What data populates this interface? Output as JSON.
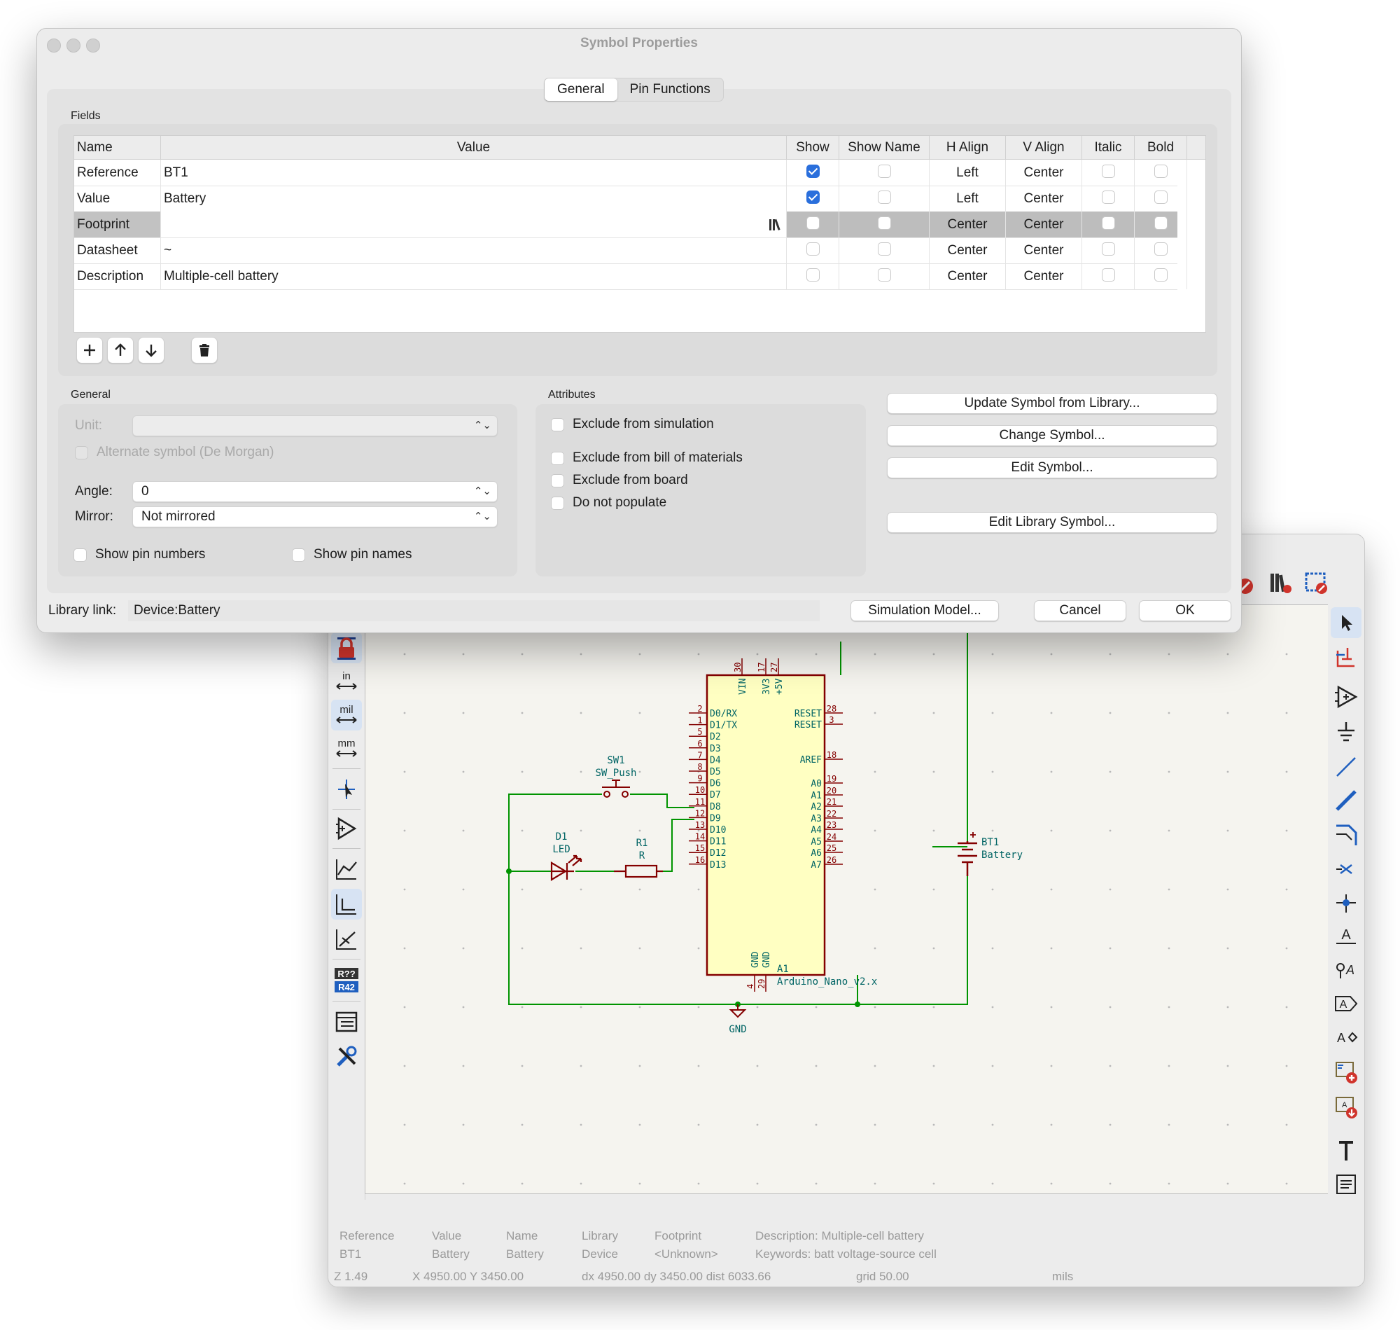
{
  "dialog": {
    "title": "Symbol Properties",
    "tabs": [
      "General",
      "Pin Functions"
    ],
    "fields_label": "Fields",
    "grid": {
      "columns": [
        "Name",
        "Value",
        "Show",
        "Show Name",
        "H Align",
        "V Align",
        "Italic",
        "Bold"
      ],
      "rows": [
        {
          "name": "Reference",
          "value": "BT1",
          "show": true,
          "show_name": false,
          "h_align": "Left",
          "v_align": "Center",
          "italic": false,
          "bold": false
        },
        {
          "name": "Value",
          "value": "Battery",
          "show": true,
          "show_name": false,
          "h_align": "Left",
          "v_align": "Center",
          "italic": false,
          "bold": false
        },
        {
          "name": "Footprint",
          "value": "",
          "show": false,
          "show_name": false,
          "h_align": "Center",
          "v_align": "Center",
          "italic": false,
          "bold": false,
          "selected": true
        },
        {
          "name": "Datasheet",
          "value": "~",
          "show": false,
          "show_name": false,
          "h_align": "Center",
          "v_align": "Center",
          "italic": false,
          "bold": false
        },
        {
          "name": "Description",
          "value": "Multiple-cell battery",
          "show": false,
          "show_name": false,
          "h_align": "Center",
          "v_align": "Center",
          "italic": false,
          "bold": false
        }
      ]
    },
    "grid_buttons": [
      "add-icon",
      "move-up-icon",
      "move-down-icon",
      "trash-icon"
    ],
    "general": {
      "label": "General",
      "unit_label": "Unit:",
      "alternate_label": "Alternate symbol (De Morgan)",
      "angle_label": "Angle:",
      "angle_value": "0",
      "mirror_label": "Mirror:",
      "mirror_value": "Not mirrored",
      "show_pin_numbers": "Show pin numbers",
      "show_pin_names": "Show pin names"
    },
    "attributes": {
      "label": "Attributes",
      "exclude_sim": "Exclude from simulation",
      "exclude_bom": "Exclude from bill of materials",
      "exclude_board": "Exclude from board",
      "dnp": "Do not populate"
    },
    "actions": {
      "update": "Update Symbol from Library...",
      "change": "Change Symbol...",
      "edit": "Edit Symbol...",
      "edit_lib": "Edit Library Symbol..."
    },
    "library_link_label": "Library link:",
    "library_link_value": "Device:Battery",
    "sim_model": "Simulation Model...",
    "cancel": "Cancel",
    "ok": "OK"
  },
  "schematic": {
    "sw1_ref": "SW1",
    "sw1_val": "SW_Push",
    "d1_ref": "D1",
    "d1_val": "LED",
    "r1_ref": "R1",
    "r1_val": "R",
    "bt1_ref": "BT1",
    "bt1_val": "Battery",
    "a1_ref": "A1",
    "a1_val": "Arduino_Nano_v2.x",
    "gnd_label": "GND",
    "top_pin_numbers": [
      "30",
      "17",
      "27"
    ],
    "top_pin_names": [
      "VIN",
      "3V3",
      "+5V"
    ],
    "bottom_pin_numbers": [
      "4",
      "29"
    ],
    "bottom_pin_names": [
      "GND",
      "GND"
    ],
    "left_pins": [
      {
        "num": "2",
        "name": "D0/RX"
      },
      {
        "num": "1",
        "name": "D1/TX"
      },
      {
        "num": "5",
        "name": "D2"
      },
      {
        "num": "6",
        "name": "D3"
      },
      {
        "num": "7",
        "name": "D4"
      },
      {
        "num": "8",
        "name": "D5"
      },
      {
        "num": "9",
        "name": "D6"
      },
      {
        "num": "10",
        "name": "D7"
      },
      {
        "num": "11",
        "name": "D8"
      },
      {
        "num": "12",
        "name": "D9"
      },
      {
        "num": "13",
        "name": "D10"
      },
      {
        "num": "14",
        "name": "D11"
      },
      {
        "num": "15",
        "name": "D12"
      },
      {
        "num": "16",
        "name": "D13"
      }
    ],
    "right_pins": [
      {
        "num": "28",
        "name": "RESET"
      },
      {
        "num": "3",
        "name": "RESET"
      },
      {
        "num": "18",
        "name": "AREF"
      },
      {
        "num": "19",
        "name": "A0"
      },
      {
        "num": "20",
        "name": "A1"
      },
      {
        "num": "21",
        "name": "A2"
      },
      {
        "num": "22",
        "name": "A3"
      },
      {
        "num": "23",
        "name": "A4"
      },
      {
        "num": "24",
        "name": "A5"
      },
      {
        "num": "25",
        "name": "A6"
      },
      {
        "num": "26",
        "name": "A7"
      }
    ],
    "colors": {
      "wire": "#009400",
      "symbol": "#840000",
      "body": "#ffffc2",
      "pin_text": "#009696",
      "ref_text": "#006464"
    }
  },
  "left_toolbar_icons": [
    "grid-dots-icon",
    "lock-icon",
    "units-inch-icon",
    "units-mil-icon",
    "units-mm-icon",
    "cursor-crosshair-icon",
    "hierarchy-navigator-icon",
    "line-45-icon",
    "line-90-icon",
    "line-free-icon",
    "annotate-icon",
    "properties-panel-icon",
    "preferences-icon"
  ],
  "unit_labels": {
    "in": "in",
    "mil": "mil",
    "mm": "mm",
    "annotate_top": "R??",
    "annotate_bottom": "R42"
  },
  "right_toolbar_icons": [
    "select-arrow-icon",
    "highlight-net-icon",
    "add-symbol-icon",
    "add-power-icon",
    "add-wire-icon",
    "add-bus-icon",
    "add-bus-entry-icon",
    "no-connect-icon",
    "add-junction-icon",
    "add-label-icon",
    "add-net-class-icon",
    "add-global-label-icon",
    "add-hier-label-icon",
    "add-sheet-icon",
    "import-sheet-pin-icon",
    "add-text-icon",
    "add-textbox-icon"
  ],
  "infobar": {
    "reference_label": "Reference",
    "reference_value": "BT1",
    "value_label": "Value",
    "value_value": "Battery",
    "name_label": "Name",
    "name_value": "Battery",
    "library_label": "Library",
    "library_value": "Device",
    "footprint_label": "Footprint",
    "footprint_value": "<Unknown>",
    "description": "Description: Multiple-cell battery",
    "keywords": "Keywords: batt voltage-source cell",
    "zoom": "Z 1.49",
    "xy": "X 4950.00  Y 3450.00",
    "dxdy": "dx 4950.00  dy 3450.00  dist 6033.66",
    "grid": "grid 50.00",
    "units": "mils"
  }
}
